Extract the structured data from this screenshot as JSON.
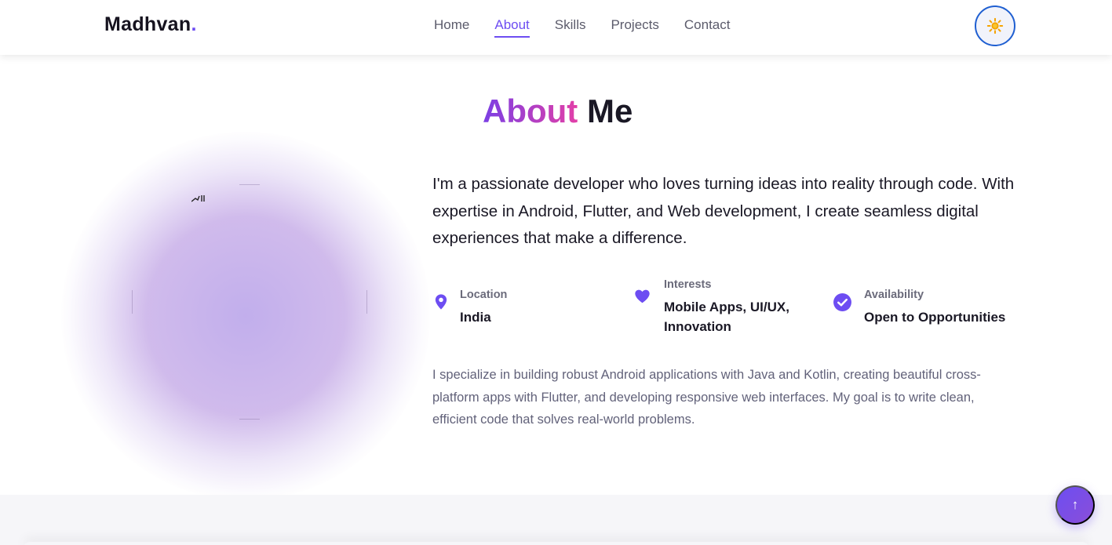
{
  "nav": {
    "logo": "Madhvan",
    "logo_dot": ".",
    "links": [
      "Home",
      "About",
      "Skills",
      "Projects",
      "Contact"
    ],
    "active": "About",
    "theme_icon": "sun-icon"
  },
  "about": {
    "title_highlight": "About",
    "title_rest": "Me",
    "lead": "I'm a passionate developer who loves turning ideas into reality through code. With expertise in Android, Flutter, and Web development, I create seamless digital experiences that make a difference.",
    "info": [
      {
        "label": "Location",
        "value": "India",
        "icon": "location-pin-icon"
      },
      {
        "label": "Interests",
        "value": "Mobile Apps, UI/UX, Innovation",
        "icon": "heart-icon"
      },
      {
        "label": "Availability",
        "value": "Open to Opportunities",
        "icon": "check-circle-icon"
      }
    ],
    "description": "I specialize in building robust Android applications with Java and Kotlin, creating beautiful cross-platform apps with Flutter, and developing responsive web interfaces. My goal is to write clean, efficient code that solves real-world problems."
  },
  "scroll_top": {
    "icon": "arrow-up-icon",
    "label": "↑"
  },
  "colors": {
    "accent": "#6d4df2",
    "gradient_start": "#7b3fe4",
    "gradient_end": "#e23fa8",
    "text": "#1a1825",
    "muted": "#62627a"
  }
}
